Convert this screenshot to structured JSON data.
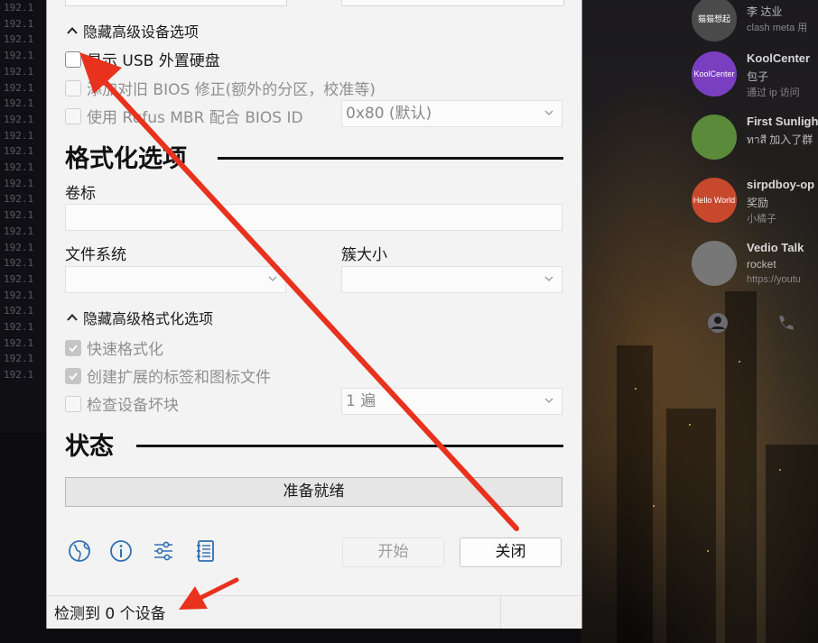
{
  "background": {
    "terminal_lines": [
      "192.1",
      "192.1",
      "192.1",
      "192.1",
      "192.1",
      "192.1",
      "192.1",
      "192.1",
      "192.1",
      "192.1",
      "192.1",
      "192.1",
      "192.1",
      "192.1",
      "192.1",
      "192.1",
      "192.1",
      "192.1",
      "192.1",
      "192.1",
      "192.1",
      "192.1",
      "192.1",
      "192.1"
    ],
    "chats": [
      {
        "avatar": "猫猫想起",
        "avatar_color": "#4b4b4b",
        "name": "",
        "line2": "李 达业",
        "line3": "clash meta 用"
      },
      {
        "avatar": "KoolCenter",
        "avatar_color": "#7a3fc0",
        "name": "KoolCenter",
        "line2": "包子",
        "line3": "通过 ip 访问"
      },
      {
        "avatar": "",
        "avatar_color": "#5a8a3a",
        "name": "First Sunligh",
        "line2": "ทาสี 加入了群",
        "line3": ""
      },
      {
        "avatar": "Hello World",
        "avatar_color": "#c8482e",
        "name": "sirpdboy-op",
        "line2": "奖励",
        "line3": "小橘子"
      },
      {
        "avatar": "",
        "avatar_color": "#777777",
        "name": "Vedio Talk",
        "line2": "rocket",
        "line3": "https://youtu"
      }
    ]
  },
  "dialog": {
    "adv_device_toggle": "隐藏高级设备选项",
    "show_usb_hdd": "显示 USB 外置硬盘",
    "add_old_bios_fixes": "添加对旧 BIOS 修正(额外的分区，校准等)",
    "use_rufus_mbr": "使用 Rufus MBR 配合 BIOS ID",
    "bios_id_value": "0x80 (默认)",
    "format_heading": "格式化选项",
    "volume_label_title": "卷标",
    "volume_label_value": "",
    "filesystem_title": "文件系统",
    "cluster_size_title": "簇大小",
    "adv_format_toggle": "隐藏高级格式化选项",
    "quick_format": "快速格式化",
    "extended_label": "创建扩展的标签和图标文件",
    "check_bad_blocks": "检查设备坏块",
    "passes_value": "1 遍",
    "status_heading": "状态",
    "progress_text": "准备就绪",
    "start_button": "开始",
    "close_button": "关闭",
    "status_bar_text": "检测到 0 个设备",
    "icons": [
      "globe-icon",
      "info-icon",
      "settings-sliders-icon",
      "log-icon"
    ],
    "accent_color": "#2f6fb4"
  },
  "annotation_color": "#e8321e"
}
